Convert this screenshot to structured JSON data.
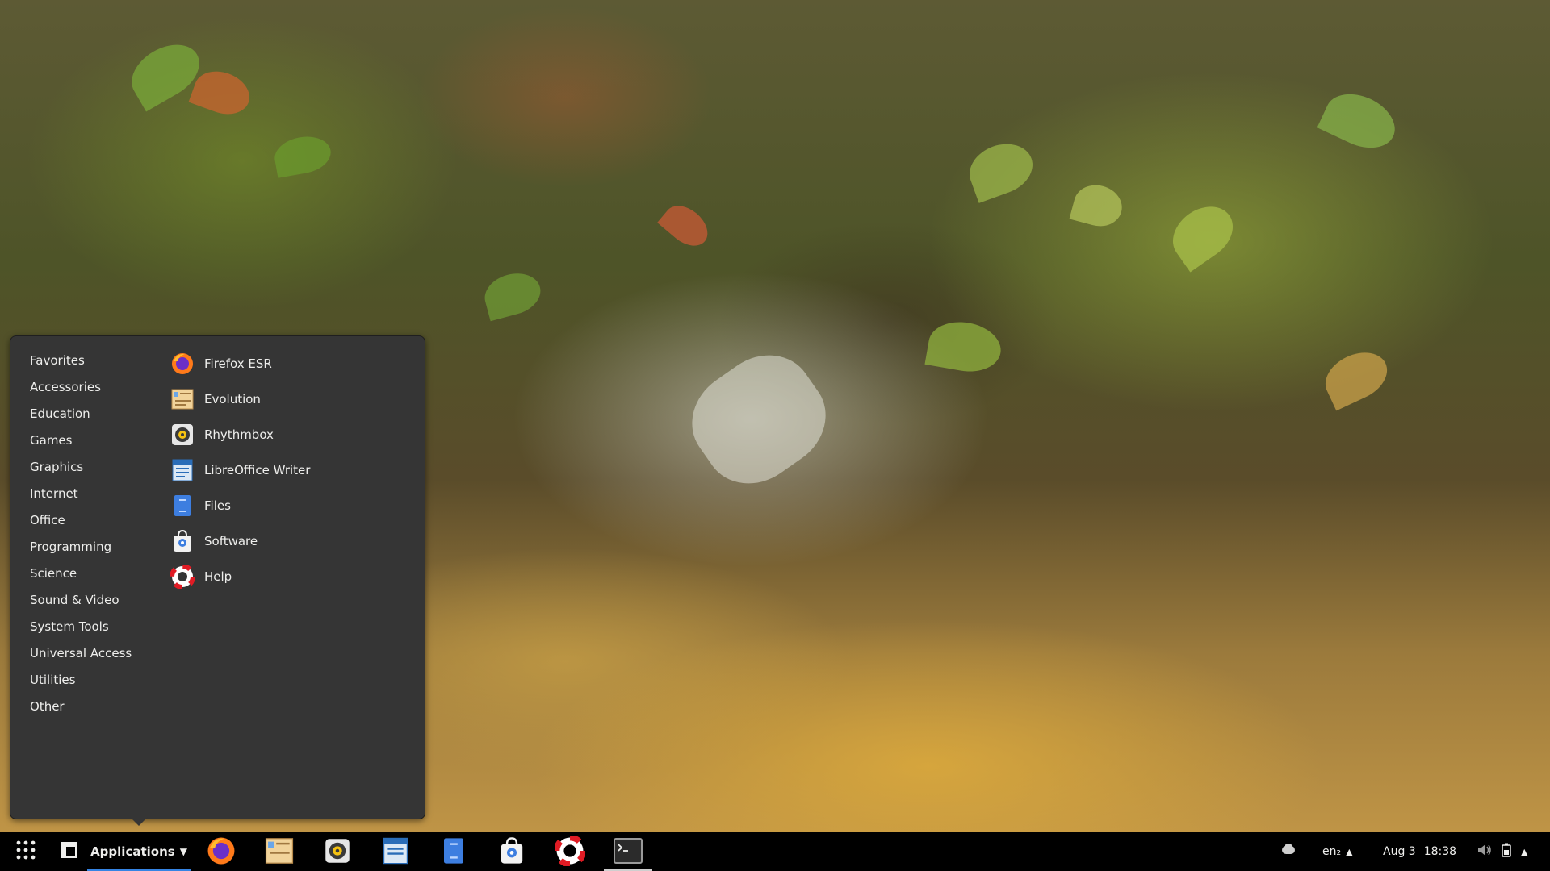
{
  "menu": {
    "categories": [
      "Favorites",
      "Accessories",
      "Education",
      "Games",
      "Graphics",
      "Internet",
      "Office",
      "Programming",
      "Science",
      "Sound & Video",
      "System Tools",
      "Universal Access",
      "Utilities",
      "Other"
    ],
    "apps": [
      {
        "label": "Firefox ESR",
        "icon": "firefox-icon"
      },
      {
        "label": "Evolution",
        "icon": "evolution-icon"
      },
      {
        "label": "Rhythmbox",
        "icon": "rhythmbox-icon"
      },
      {
        "label": "LibreOffice Writer",
        "icon": "libreoffice-writer-icon"
      },
      {
        "label": "Files",
        "icon": "files-icon"
      },
      {
        "label": "Software",
        "icon": "software-icon"
      },
      {
        "label": "Help",
        "icon": "help-icon"
      }
    ]
  },
  "panel": {
    "applications_label": "Applications",
    "taskbar": [
      "firefox-icon",
      "evolution-icon",
      "rhythmbox-icon",
      "libreoffice-writer-icon",
      "files-icon",
      "software-icon",
      "help-icon",
      "terminal-icon"
    ],
    "keyboard_layout": "en₂",
    "date": "Aug 3",
    "time": "18:38"
  },
  "colors": {
    "menu_bg": "#353535",
    "panel_bg": "#000000",
    "accent": "#3584e4"
  }
}
